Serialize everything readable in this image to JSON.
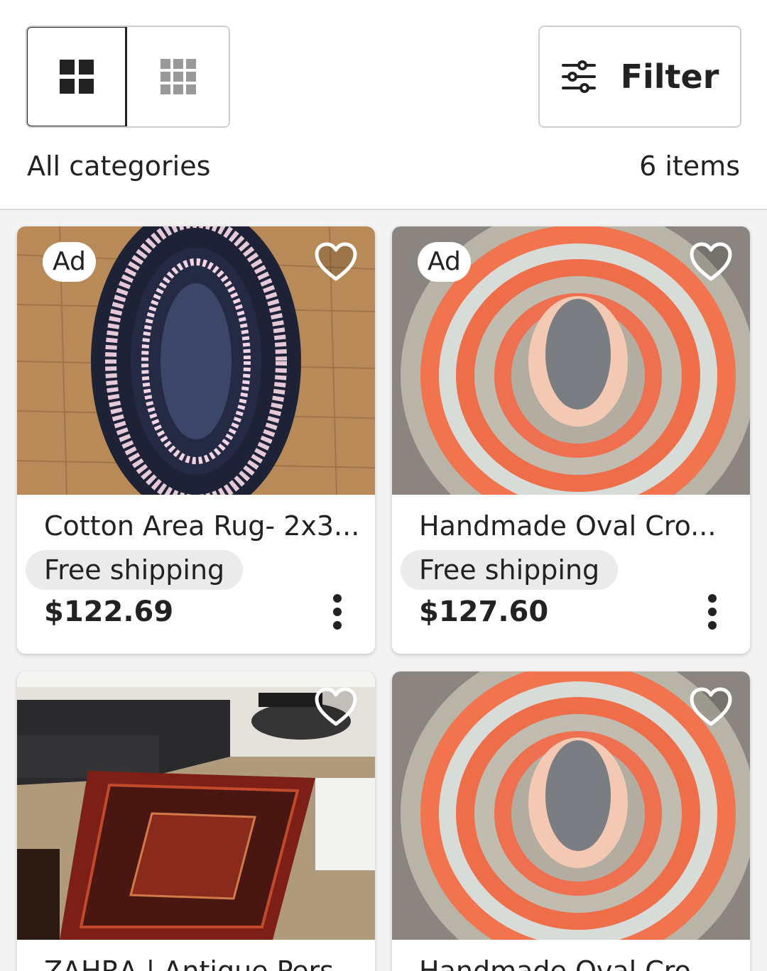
{
  "toolbar": {
    "view_large_grid_icon": "grid-2x2-icon",
    "view_small_grid_icon": "grid-3x3-icon",
    "filter_label": "Filter",
    "filter_icon": "sliders-icon"
  },
  "summary": {
    "category": "All categories",
    "count": "6 items"
  },
  "listings": [
    {
      "ad": "Ad",
      "title": "Cotton Area Rug- 2x3...",
      "shipping": "Free shipping",
      "price": "$122.69"
    },
    {
      "ad": "Ad",
      "title": "Handmade Oval Cro...",
      "shipping": "Free shipping",
      "price": "$127.60"
    },
    {
      "title": "ZAHRA | Antique Pers..."
    },
    {
      "title": "Handmade Oval Cro..."
    }
  ],
  "colors": {
    "accent_text": "#222222",
    "badge_bg": "#ffffff",
    "shipping_bg": "#ebebeb",
    "page_bg": "#f3f3f3"
  }
}
